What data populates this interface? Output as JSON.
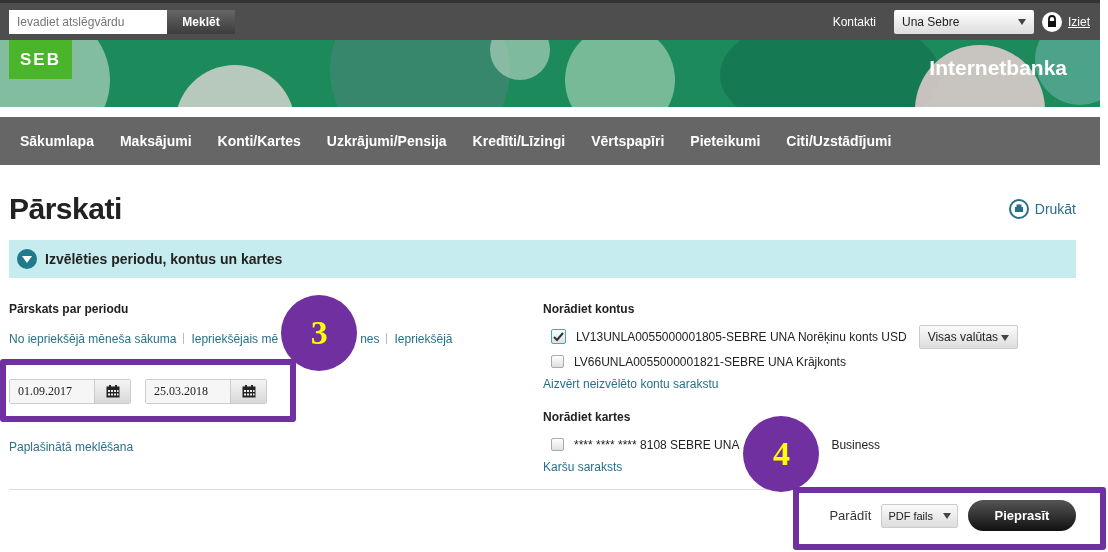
{
  "topbar": {
    "search": {
      "placeholder": "Ievadiet atslēgvārdu"
    },
    "search_button": "Meklēt",
    "contacts": "Kontakti",
    "user_select": "Una Sebre",
    "logout": "Iziet"
  },
  "banner": {
    "logo": "SEB",
    "title": "Internetbanka"
  },
  "nav": [
    {
      "label": "Sākumlapa"
    },
    {
      "label": "Maksājumi"
    },
    {
      "label": "Konti/Kartes"
    },
    {
      "label": "Uzkrājumi/Pensija"
    },
    {
      "label": "Kredīti/Līzingi"
    },
    {
      "label": "Vērtspapīri"
    },
    {
      "label": "Pieteikumi"
    },
    {
      "label": "Citi/Uzstādījumi"
    }
  ],
  "page": {
    "title": "Pārskati",
    "print": "Drukāt"
  },
  "accordion": {
    "title": "Izvēlēties periodu, kontus un kartes",
    "expanded": true
  },
  "period": {
    "heading": "Pārskats par periodu",
    "quick_links": [
      {
        "label": "No iepriekšējā mēneša sākuma"
      },
      {
        "label": "Iepriekšējais mē"
      },
      {
        "label": "nes"
      },
      {
        "label": "Iepriekšējā"
      }
    ],
    "date_from": "01.09.2017",
    "date_to": "25.03.2018",
    "advanced_search": "Paplašinātā meklēšana"
  },
  "accounts": {
    "heading": "Norādiet kontus",
    "items": [
      {
        "label": "LV13UNLA0055000001805-SEBRE UNA Norēķinu konts USD",
        "checked": true,
        "currency_select": "Visas valūtas"
      },
      {
        "label": "LV66UNLA0055000001821-SEBRE UNA Krājkonts",
        "checked": false
      }
    ],
    "close_link": "Aizvērt neizvēlēto kontu sarakstu"
  },
  "cards": {
    "heading": "Norādiet kartes",
    "items": [
      {
        "label_start": "**** **** **** 8108 SEBRE UNA",
        "label_end": "Business",
        "checked": false
      }
    ],
    "list_link": "Karšu saraksts"
  },
  "footer": {
    "show_label": "Parādīt",
    "format_select": "PDF fails",
    "submit": "Pieprasīt"
  },
  "annotations": [
    {
      "label": "3"
    },
    {
      "label": "4"
    }
  ]
}
